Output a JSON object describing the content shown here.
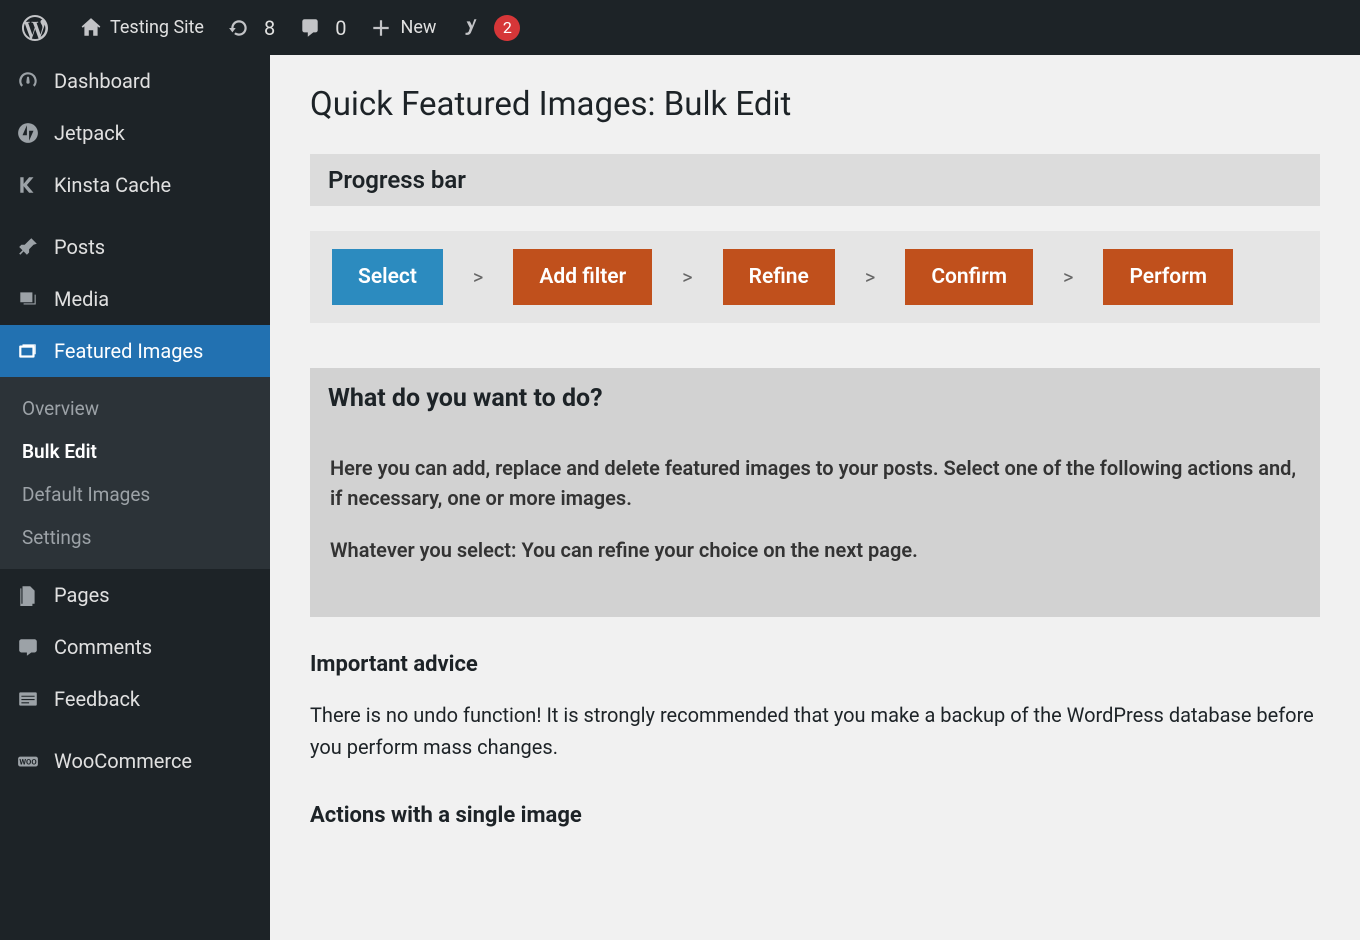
{
  "adminbar": {
    "site_name": "Testing Site",
    "updates_count": "8",
    "comments_count": "0",
    "new_label": "New",
    "yoast_badge": "2"
  },
  "sidebar": {
    "items": [
      {
        "label": "Dashboard"
      },
      {
        "label": "Jetpack"
      },
      {
        "label": "Kinsta Cache"
      },
      {
        "label": "Posts"
      },
      {
        "label": "Media"
      },
      {
        "label": "Featured Images"
      },
      {
        "label": "Pages"
      },
      {
        "label": "Comments"
      },
      {
        "label": "Feedback"
      },
      {
        "label": "WooCommerce"
      }
    ],
    "submenu": [
      {
        "label": "Overview"
      },
      {
        "label": "Bulk Edit"
      },
      {
        "label": "Default Images"
      },
      {
        "label": "Settings"
      }
    ]
  },
  "main": {
    "title": "Quick Featured Images: Bulk Edit",
    "progress_header": "Progress bar",
    "steps": [
      "Select",
      "Add filter",
      "Refine",
      "Confirm",
      "Perform"
    ],
    "step_separator": ">",
    "panel_title": "What do you want to do?",
    "panel_p1": "Here you can add, replace and delete featured images to your posts. Select one of the following actions and, if necessary, one or more images.",
    "panel_p2": "Whatever you select: You can refine your choice on the next page.",
    "advice_title": "Important advice",
    "advice_text": "There is no undo function! It is strongly recommended that you make a backup of the WordPress database before you perform mass changes.",
    "actions_title": "Actions with a single image"
  },
  "colors": {
    "step_current": "#2c8bbf",
    "step_pending": "#c0501c",
    "active_menu": "#2271b1"
  }
}
